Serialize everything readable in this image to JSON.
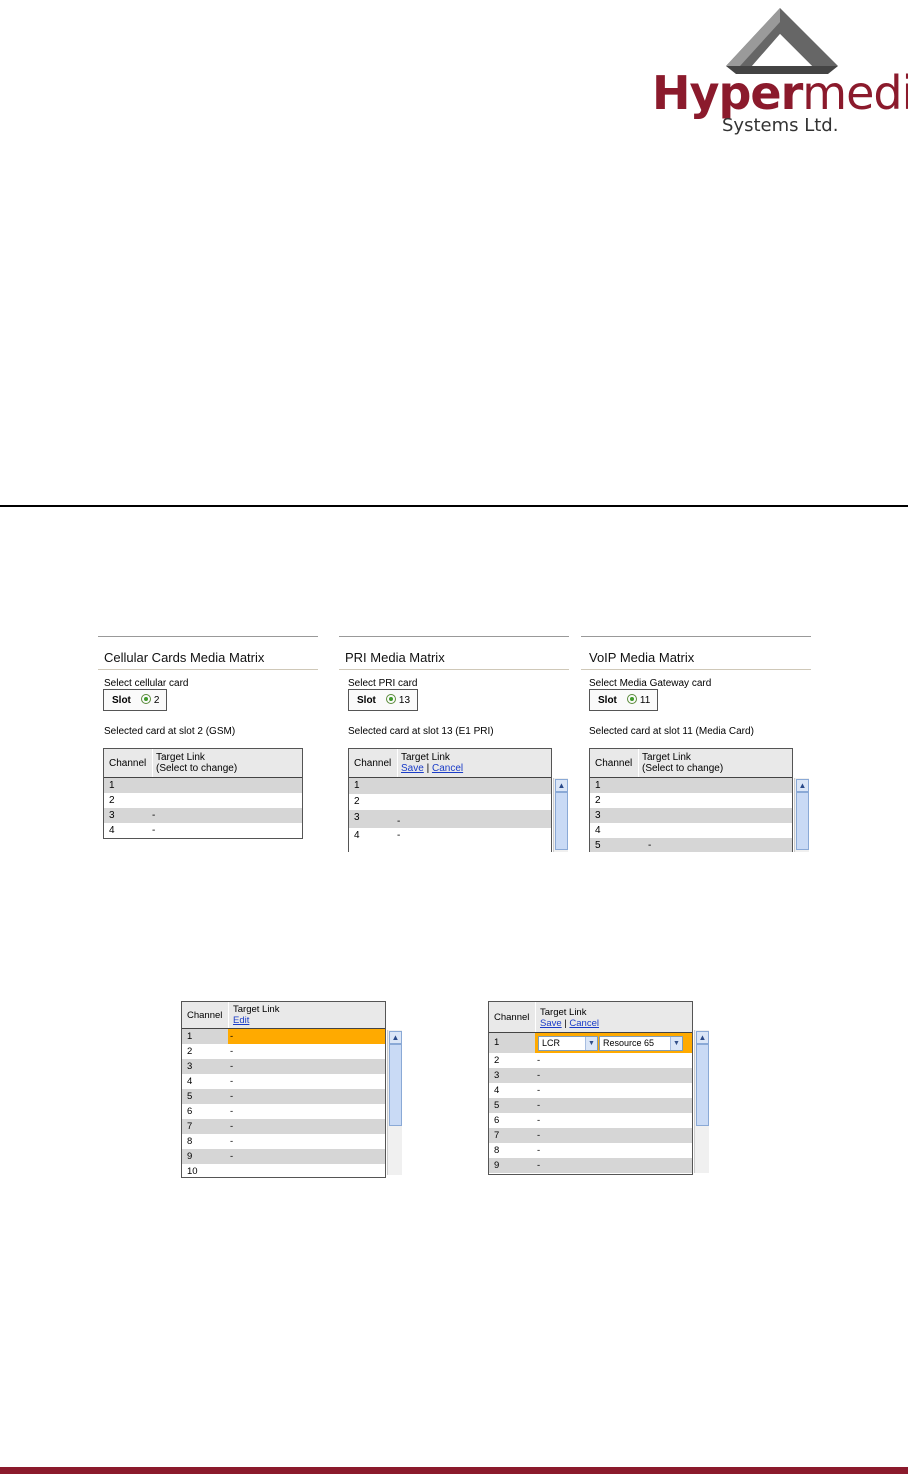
{
  "logo": {
    "brand_bold": "Hyper",
    "brand_rest": "media",
    "subtitle": "Systems Ltd."
  },
  "panels": [
    {
      "title": "Cellular Cards Media Matrix",
      "select_label": "Select cellular card",
      "slot_label": "Slot",
      "slot_value": "2",
      "selected_text": "Selected card at slot 2 (GSM)",
      "col_channel": "Channel",
      "col_target": "Target Link",
      "col_target_sub": "(Select to change)",
      "rows": [
        {
          "ch": "1",
          "target": ""
        },
        {
          "ch": "2",
          "target": ""
        },
        {
          "ch": "3",
          "target": "-"
        },
        {
          "ch": "4",
          "target": "-"
        }
      ]
    },
    {
      "title": "PRI Media Matrix",
      "select_label": "Select PRI card",
      "slot_label": "Slot",
      "slot_value": "13",
      "selected_text": "Selected card at slot 13 (E1 PRI)",
      "col_channel": "Channel",
      "col_target": "Target Link",
      "save_label": "Save",
      "separator": "|",
      "cancel_label": "Cancel",
      "rows": [
        {
          "ch": "1",
          "target": ""
        },
        {
          "ch": "2",
          "target": ""
        },
        {
          "ch": "3",
          "target": "-"
        },
        {
          "ch": "4",
          "target": "-"
        }
      ]
    },
    {
      "title": "VoIP Media Matrix",
      "select_label": "Select Media Gateway card",
      "slot_label": "Slot",
      "slot_value": "11",
      "selected_text": "Selected card at slot 11 (Media Card)",
      "col_channel": "Channel",
      "col_target": "Target Link",
      "col_target_sub": "(Select to change)",
      "rows": [
        {
          "ch": "1",
          "target": ""
        },
        {
          "ch": "2",
          "target": ""
        },
        {
          "ch": "3",
          "target": ""
        },
        {
          "ch": "4",
          "target": ""
        },
        {
          "ch": "5",
          "target": "-"
        }
      ]
    }
  ],
  "edit_table": {
    "col_channel": "Channel",
    "col_target": "Target Link",
    "edit_label": "Edit",
    "rows": [
      {
        "ch": "1",
        "target": "-"
      },
      {
        "ch": "2",
        "target": "-"
      },
      {
        "ch": "3",
        "target": "-"
      },
      {
        "ch": "4",
        "target": "-"
      },
      {
        "ch": "5",
        "target": "-"
      },
      {
        "ch": "6",
        "target": "-"
      },
      {
        "ch": "7",
        "target": "-"
      },
      {
        "ch": "8",
        "target": "-"
      },
      {
        "ch": "9",
        "target": "-"
      },
      {
        "ch": "10",
        "target": ""
      }
    ]
  },
  "save_table": {
    "col_channel": "Channel",
    "col_target": "Target Link",
    "save_label": "Save",
    "separator": "|",
    "cancel_label": "Cancel",
    "dropdown_type": "LCR",
    "dropdown_resource": "Resource 65",
    "rows": [
      {
        "ch": "1",
        "target": ""
      },
      {
        "ch": "2",
        "target": "-"
      },
      {
        "ch": "3",
        "target": "-"
      },
      {
        "ch": "4",
        "target": "-"
      },
      {
        "ch": "5",
        "target": "-"
      },
      {
        "ch": "6",
        "target": "-"
      },
      {
        "ch": "7",
        "target": "-"
      },
      {
        "ch": "8",
        "target": "-"
      },
      {
        "ch": "9",
        "target": "-"
      }
    ]
  },
  "colors": {
    "brand": "#8b1a2c",
    "highlight": "#ffaa00",
    "link": "#1a3cc8"
  }
}
